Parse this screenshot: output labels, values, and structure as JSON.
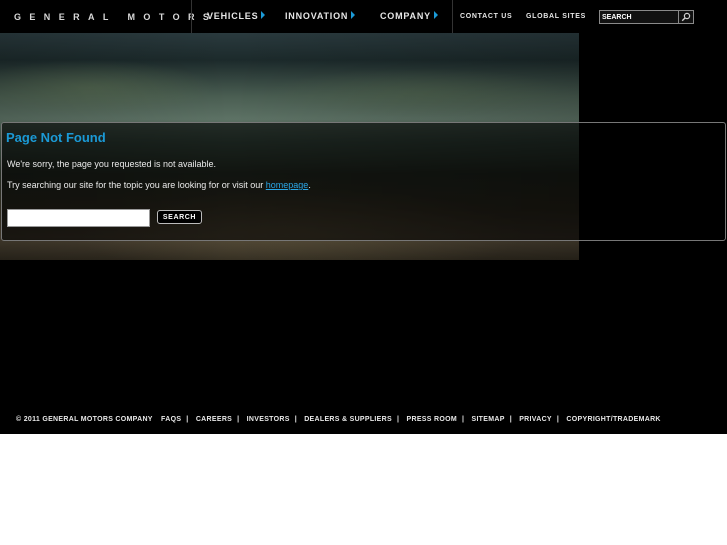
{
  "brand": {
    "name": "GENERAL MOTORS"
  },
  "nav": {
    "items": [
      {
        "label": "VEHICLES"
      },
      {
        "label": "INNOVATION"
      },
      {
        "label": "COMPANY"
      }
    ],
    "accent_color": "#1b9ad6"
  },
  "utility": {
    "contact": "CONTACT US",
    "global": "GLOBAL SITES",
    "search_placeholder": "SEARCH",
    "search_icon": "magnifier-icon"
  },
  "content": {
    "title": "Page Not Found",
    "message1": "We're sorry, the page you requested is not available.",
    "message2_prefix": "Try searching our site for the topic you are looking for or visit our ",
    "homepage_link": "homepage",
    "message2_suffix": ".",
    "search_value": "",
    "search_button": "SEARCH"
  },
  "footer": {
    "copyright": "© 2011 GENERAL MOTORS COMPANY",
    "links": [
      "FAQS",
      "CAREERS",
      "INVESTORS",
      "DEALERS & SUPPLIERS",
      "PRESS ROOM",
      "SITEMAP",
      "PRIVACY",
      "COPYRIGHT/TRADEMARK"
    ]
  }
}
